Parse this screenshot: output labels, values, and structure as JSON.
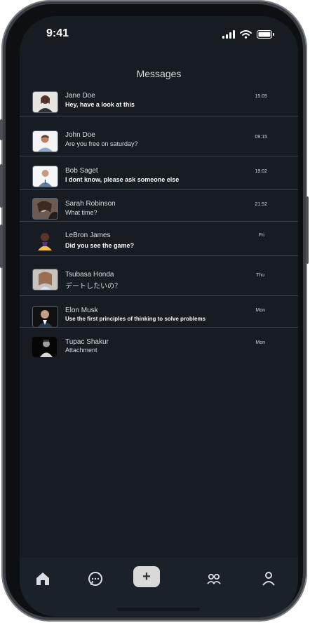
{
  "status": {
    "time": "9:41",
    "signal_icon": "signal-icon",
    "wifi_icon": "wifi-icon",
    "battery_icon": "battery-icon"
  },
  "header": {
    "title": "Messages"
  },
  "messages": [
    {
      "name": "Jane Doe",
      "text": "Hey, have a look at this",
      "time": "15:05",
      "emphasis": "bold",
      "avatar_icon": "avatar-icon"
    },
    {
      "name": "John Doe",
      "text": "Are you free on saturday?",
      "time": "09:15",
      "emphasis": "regular",
      "avatar_icon": "avatar-icon"
    },
    {
      "name": "Bob Saget",
      "text": "I dont know, please ask someone else",
      "time": "19:02",
      "emphasis": "bold",
      "avatar_icon": "avatar-icon"
    },
    {
      "name": "Sarah Robinson",
      "text": "What time?",
      "time": "21:52",
      "emphasis": "regular",
      "avatar_icon": "avatar-icon"
    },
    {
      "name": "LeBron James",
      "text": "Did you see the game?",
      "time": "Fri",
      "emphasis": "bold",
      "avatar_icon": "avatar-icon"
    },
    {
      "name": "Tsubasa Honda",
      "text": "デートしたいの？",
      "time": "Thu",
      "emphasis": "regular",
      "avatar_icon": "avatar-icon"
    },
    {
      "name": "Elon Musk",
      "text": "Use the first principles of thinking to solve problems",
      "time": "Mon",
      "emphasis": "bold",
      "avatar_icon": "avatar-icon"
    },
    {
      "name": "Tupac Shakur",
      "text": "Attachment",
      "time": "Mon",
      "emphasis": "regular",
      "avatar_icon": "avatar-icon"
    }
  ],
  "tabbar": {
    "home_icon": "home-icon",
    "chat_icon": "chat-icon",
    "new_label": "+",
    "groups_icon": "groups-icon",
    "profile_icon": "profile-icon"
  },
  "colors": {
    "screen": "#171c22",
    "tabbar": "#1b2128",
    "divider": "#3a424b",
    "text": "#d9dee3",
    "button": "#d9d9d9"
  }
}
